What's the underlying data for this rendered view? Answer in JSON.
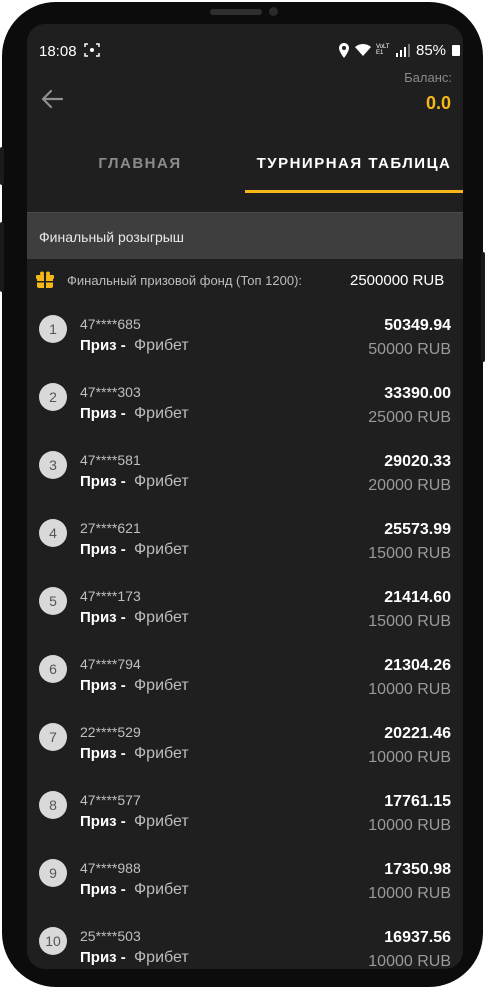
{
  "status_bar": {
    "time": "18:08",
    "network": "VoLTE1",
    "battery": "85%"
  },
  "header": {
    "balance_label": "Баланс:",
    "balance_value": "0.0"
  },
  "tabs": [
    {
      "label": "ГЛАВНАЯ",
      "active": false
    },
    {
      "label": "ТУРНИРНАЯ ТАБЛИЦА",
      "active": true
    }
  ],
  "section": {
    "title": "Финальный розыгрыш"
  },
  "prize_fund": {
    "label": "Финальный призовой фонд (Топ 1200):",
    "value": "2500000 RUB"
  },
  "leaderboard": [
    {
      "rank": "1",
      "user": "47****685",
      "prize_label": "Приз -",
      "prize_type": "Фрибет",
      "score": "50349.94",
      "reward": "50000 RUB"
    },
    {
      "rank": "2",
      "user": "47****303",
      "prize_label": "Приз -",
      "prize_type": "Фрибет",
      "score": "33390.00",
      "reward": "25000 RUB"
    },
    {
      "rank": "3",
      "user": "47****581",
      "prize_label": "Приз -",
      "prize_type": "Фрибет",
      "score": "29020.33",
      "reward": "20000 RUB"
    },
    {
      "rank": "4",
      "user": "27****621",
      "prize_label": "Приз -",
      "prize_type": "Фрибет",
      "score": "25573.99",
      "reward": "15000 RUB"
    },
    {
      "rank": "5",
      "user": "47****173",
      "prize_label": "Приз -",
      "prize_type": "Фрибет",
      "score": "21414.60",
      "reward": "15000 RUB"
    },
    {
      "rank": "6",
      "user": "47****794",
      "prize_label": "Приз -",
      "prize_type": "Фрибет",
      "score": "21304.26",
      "reward": "10000 RUB"
    },
    {
      "rank": "7",
      "user": "22****529",
      "prize_label": "Приз -",
      "prize_type": "Фрибет",
      "score": "20221.46",
      "reward": "10000 RUB"
    },
    {
      "rank": "8",
      "user": "47****577",
      "prize_label": "Приз -",
      "prize_type": "Фрибет",
      "score": "17761.15",
      "reward": "10000 RUB"
    },
    {
      "rank": "9",
      "user": "47****988",
      "prize_label": "Приз -",
      "prize_type": "Фрибет",
      "score": "17350.98",
      "reward": "10000 RUB"
    },
    {
      "rank": "10",
      "user": "25****503",
      "prize_label": "Приз -",
      "prize_type": "Фрибет",
      "score": "16937.56",
      "reward": "10000 RUB"
    }
  ],
  "colors": {
    "accent": "#f5b818",
    "background": "#1f1f1f",
    "section": "#3e3e3e",
    "rank_circle": "#d9d9d9"
  },
  "icons": [
    "back-arrow-icon",
    "gift-icon",
    "wifi-icon",
    "signal-icon",
    "battery-icon",
    "location-icon",
    "screen-record-icon"
  ]
}
